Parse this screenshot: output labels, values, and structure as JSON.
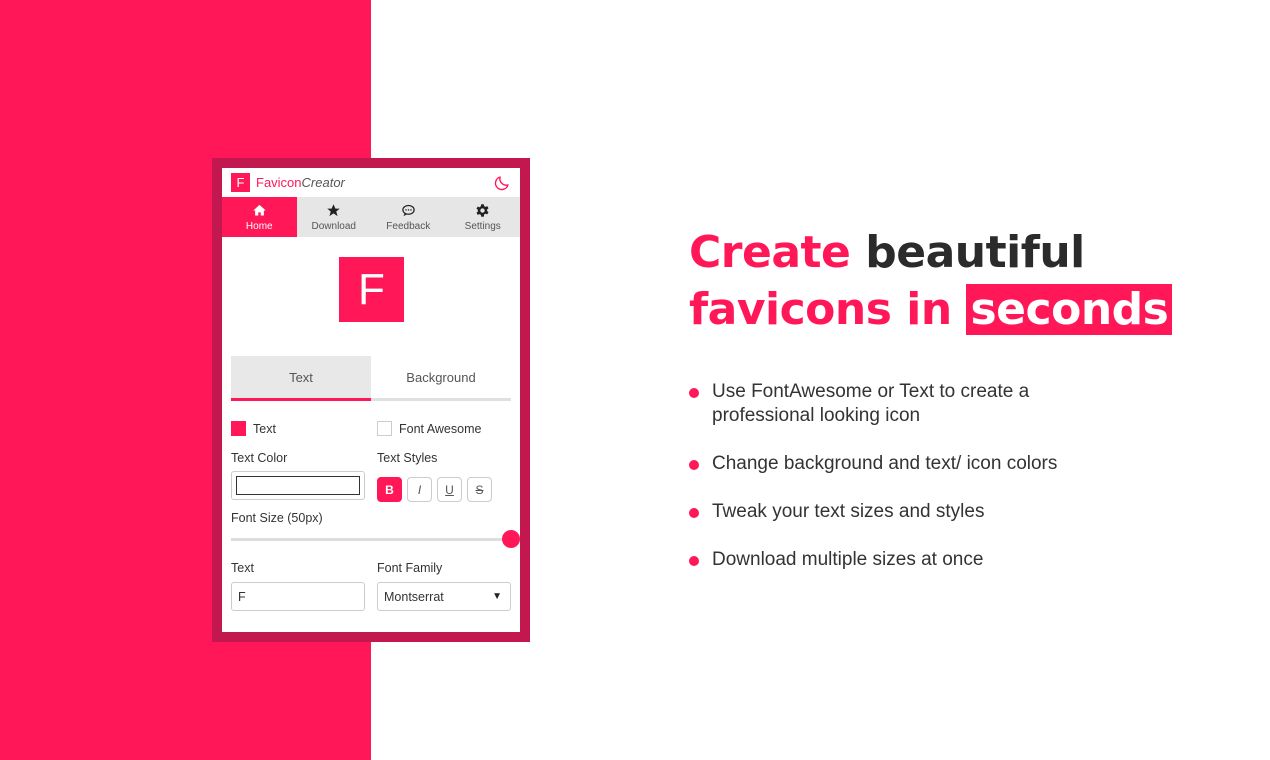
{
  "colors": {
    "accent": "#ff1758",
    "frame": "#c2174f",
    "dark_text": "#2b2b2b"
  },
  "popup": {
    "logo_letter": "F",
    "brand_part1": "Favicon",
    "brand_part2": "Creator",
    "theme_icon": "moon-icon",
    "nav": [
      {
        "label": "Home",
        "icon": "home-icon",
        "active": true
      },
      {
        "label": "Download",
        "icon": "star-icon",
        "active": false
      },
      {
        "label": "Feedback",
        "icon": "comment-icon",
        "active": false
      },
      {
        "label": "Settings",
        "icon": "gear-icon",
        "active": false
      }
    ],
    "preview_letter": "F",
    "tabs": [
      {
        "label": "Text",
        "active": true
      },
      {
        "label": "Background",
        "active": false
      }
    ],
    "mode_text": {
      "label": "Text",
      "checked": true
    },
    "mode_fa": {
      "label": "Font Awesome",
      "checked": false
    },
    "text_color_label": "Text Color",
    "text_styles_label": "Text Styles",
    "style_buttons": [
      {
        "label": "B",
        "active": true
      },
      {
        "label": "I",
        "active": false
      },
      {
        "label": "U",
        "active": false
      },
      {
        "label": "S",
        "active": false
      }
    ],
    "font_size_label": "Font Size (50px)",
    "font_size_fraction": 1.0,
    "text_label": "Text",
    "text_value": "F",
    "font_family_label": "Font Family",
    "font_family_value": "Montserrat"
  },
  "headline": {
    "w1": "Create",
    "w2": "beautiful",
    "w3": "favicons in",
    "w4": "seconds"
  },
  "bullets": [
    "Use FontAwesome or Text to create a professional looking icon",
    "Change background and text/ icon colors",
    "Tweak your text sizes and styles",
    "Download multiple sizes at once"
  ]
}
